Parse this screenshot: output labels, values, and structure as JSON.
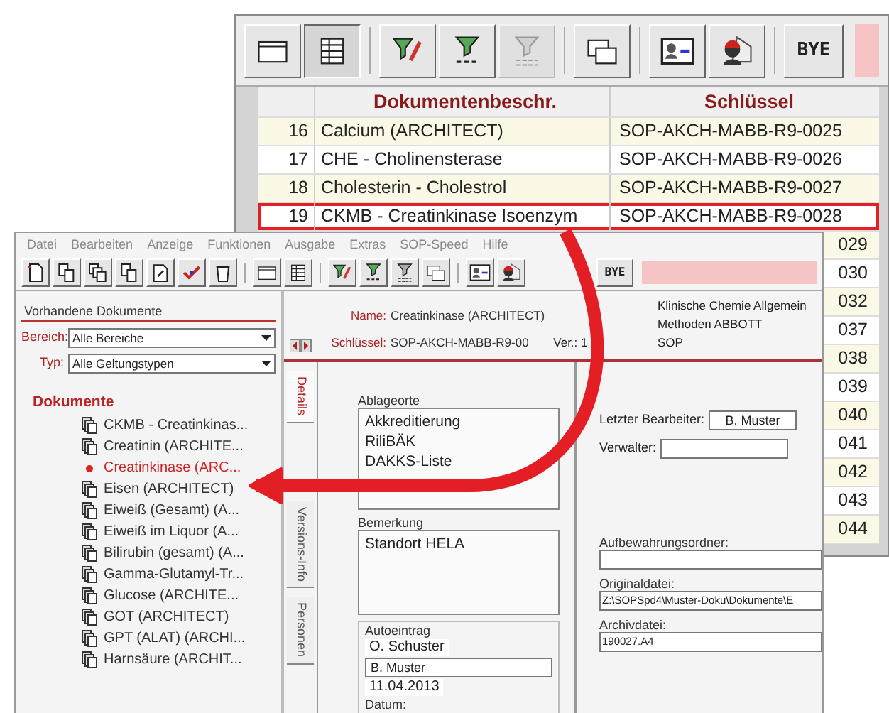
{
  "back_window": {
    "toolbar": [
      {
        "kind": "window",
        "pressed": false,
        "disabled": false
      },
      {
        "kind": "table",
        "pressed": true,
        "disabled": false
      },
      {
        "kind": "separator"
      },
      {
        "kind": "filter-edit",
        "pressed": false,
        "disabled": false
      },
      {
        "kind": "filter",
        "pressed": false,
        "disabled": false
      },
      {
        "kind": "filter-list",
        "pressed": false,
        "disabled": true
      },
      {
        "kind": "separator"
      },
      {
        "kind": "windows",
        "pressed": false,
        "disabled": false
      },
      {
        "kind": "separator"
      },
      {
        "kind": "card",
        "pressed": false,
        "disabled": false
      },
      {
        "kind": "person",
        "pressed": false,
        "disabled": false
      },
      {
        "kind": "separator"
      },
      {
        "kind": "text",
        "label": "BYE"
      },
      {
        "kind": "panel"
      }
    ],
    "table": {
      "columns": [
        "Dokumentenbeschr.",
        "Schlüssel"
      ],
      "rows": [
        {
          "number": "16",
          "description": "Calcium  (ARCHITECT)",
          "key": "SOP-AKCH-MABB-R9-0025",
          "selected": false
        },
        {
          "number": "17",
          "description": "CHE - Cholinensterase",
          "key": "SOP-AKCH-MABB-R9-0026",
          "selected": false
        },
        {
          "number": "18",
          "description": "Cholesterin - Cholestrol",
          "key": "SOP-AKCH-MABB-R9-0027",
          "selected": false
        },
        {
          "number": "19",
          "description": "CKMB - Creatinkinase Isoenzym",
          "key": "SOP-AKCH-MABB-R9-0028",
          "selected": true
        }
      ],
      "covered_rows": [
        {
          "key_end": "029"
        },
        {
          "key_end": "030"
        },
        {
          "key_end": "032"
        },
        {
          "key_end": "037"
        },
        {
          "key_end": "038"
        },
        {
          "key_end": "039"
        },
        {
          "key_end": "040"
        },
        {
          "key_end": "041"
        },
        {
          "key_end": "042"
        },
        {
          "key_end": "043"
        },
        {
          "key_end": "044"
        }
      ]
    }
  },
  "front_window": {
    "menu": [
      "Datei",
      "Bearbeiten",
      "Anzeige",
      "Funktionen",
      "Ausgabe",
      "Extras",
      "SOP-Speed",
      "Hilfe"
    ],
    "toolbar": [
      {
        "kind": "doc-new"
      },
      {
        "kind": "doc-copy"
      },
      {
        "kind": "doc-copies"
      },
      {
        "kind": "doc-copy"
      },
      {
        "kind": "doc-edit"
      },
      {
        "kind": "check"
      },
      {
        "kind": "trash"
      },
      {
        "kind": "separator"
      },
      {
        "kind": "window"
      },
      {
        "kind": "table"
      },
      {
        "kind": "separator"
      },
      {
        "kind": "filter-edit"
      },
      {
        "kind": "filter"
      },
      {
        "kind": "filter-list"
      },
      {
        "kind": "windows"
      },
      {
        "kind": "separator"
      },
      {
        "kind": "card"
      },
      {
        "kind": "person"
      },
      {
        "kind": "text",
        "label": "BYE"
      },
      {
        "kind": "panel"
      }
    ],
    "sidebar": {
      "title": "Vorhandene Dokumente",
      "filters": [
        {
          "label": "Bereich:",
          "value": "Alle Bereiche"
        },
        {
          "label": "Typ:",
          "value": "Alle Geltungstypen"
        }
      ],
      "tree": {
        "label": "Dokumente",
        "items": [
          {
            "label": "CKMB - Creatinkinas...",
            "selected": false
          },
          {
            "label": "Creatinin  (ARCHITE...",
            "selected": false
          },
          {
            "label": "Creatinkinase  (ARC...",
            "selected": true
          },
          {
            "label": "Eisen  (ARCHITECT)",
            "selected": false
          },
          {
            "label": "Eiweiß (Gesamt)  (A...",
            "selected": false
          },
          {
            "label": "Eiweiß im Liquor  (A...",
            "selected": false
          },
          {
            "label": "Bilirubin (gesamt)  (A...",
            "selected": false
          },
          {
            "label": "Gamma-Glutamyl-Tr...",
            "selected": false
          },
          {
            "label": "Glucose  (ARCHITE...",
            "selected": false
          },
          {
            "label": "GOT  (ARCHITECT)",
            "selected": false
          },
          {
            "label": "GPT (ALAT)  (ARCHI...",
            "selected": false
          },
          {
            "label": "Harnsäure  (ARCHIT...",
            "selected": false
          }
        ]
      }
    },
    "document": {
      "name_label": "Name:",
      "name": "Creatinkinase (ARCHITECT)",
      "key_label": "Schlüssel:",
      "key": "SOP-AKCH-MABB-R9-00",
      "version": "Ver.: 1",
      "info": [
        "Klinische Chemie Allgemein",
        "Methoden ABBOTT",
        "SOP"
      ],
      "tabs": [
        {
          "label": "Details",
          "selected": true
        },
        {
          "label": "Versions-Info",
          "selected": false
        },
        {
          "label": "Personen",
          "selected": false
        }
      ],
      "storage": {
        "label": "Ablageorte",
        "items": [
          "Akkreditierung",
          "RiliBÄK",
          "DAKKS-Liste"
        ]
      },
      "remark": {
        "label": "Bemerkung",
        "text": "Standort HELA"
      },
      "auto": {
        "label": "Autoeintrag",
        "author": "O. Schuster",
        "reviewer": "B. Muster",
        "date": "11.04.2013",
        "date_label": "Datum:"
      },
      "people": [
        {
          "label": "Letzter Bearbeiter:",
          "value": "B. Muster"
        },
        {
          "label": "Verwalter:"
        }
      ],
      "files": [
        {
          "label": "Aufbewahrungsordner:"
        },
        {
          "label": "Originaldatei:",
          "value": "Z:\\SOPSpd4\\Muster-Doku\\Dokumente\\E"
        },
        {
          "label": "Archivdatei:",
          "value": "190027.A4"
        }
      ]
    }
  }
}
